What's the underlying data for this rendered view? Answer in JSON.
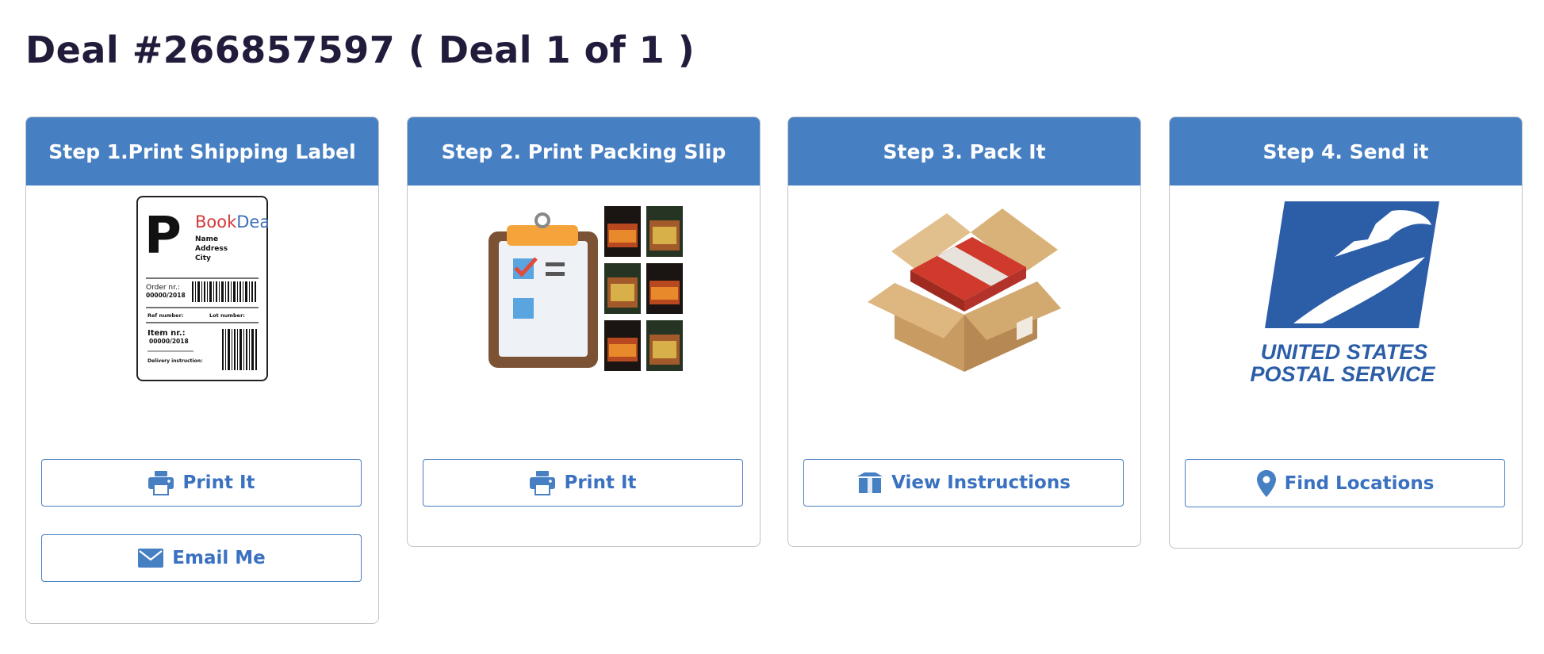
{
  "page": {
    "title": "Deal #266857597 ( Deal 1 of 1 )"
  },
  "steps": [
    {
      "header": "Step 1.Print Shipping Label",
      "image": "shipping-label-illustration",
      "label_art": {
        "letter": "P",
        "brand": "BookDeal",
        "brand_part1": "Book",
        "brand_part2": "Deal",
        "lines": [
          "Name",
          "Address",
          "City"
        ],
        "order_label": "Order nr.:",
        "order_value": "00000/2018",
        "ref_label": "Ref number:",
        "lot_label": "Lot number:",
        "item_label": "Item nr.:",
        "item_value": "00000/2018",
        "delivery_label": "Delivery instruction:"
      },
      "buttons": [
        {
          "label": "Print It",
          "icon": "printer-icon"
        },
        {
          "label": "Email Me",
          "icon": "envelope-icon"
        }
      ]
    },
    {
      "header": "Step 2. Print Packing Slip",
      "image": "packing-slip-illustration",
      "buttons": [
        {
          "label": "Print It",
          "icon": "printer-icon"
        }
      ]
    },
    {
      "header": "Step 3. Pack It",
      "image": "open-box-illustration",
      "buttons": [
        {
          "label": "View Instructions",
          "icon": "box-icon"
        }
      ]
    },
    {
      "header": "Step 4. Send it",
      "image": "usps-logo",
      "logo_text": [
        "UNITED STATES",
        "POSTAL SERVICE"
      ],
      "buttons": [
        {
          "label": "Find Locations",
          "icon": "map-pin-icon"
        }
      ]
    }
  ],
  "colors": {
    "header_bg": "#477fc3",
    "button_text": "#3a71c1",
    "title_text": "#231b3b",
    "usps_blue": "#2c5ea8"
  }
}
